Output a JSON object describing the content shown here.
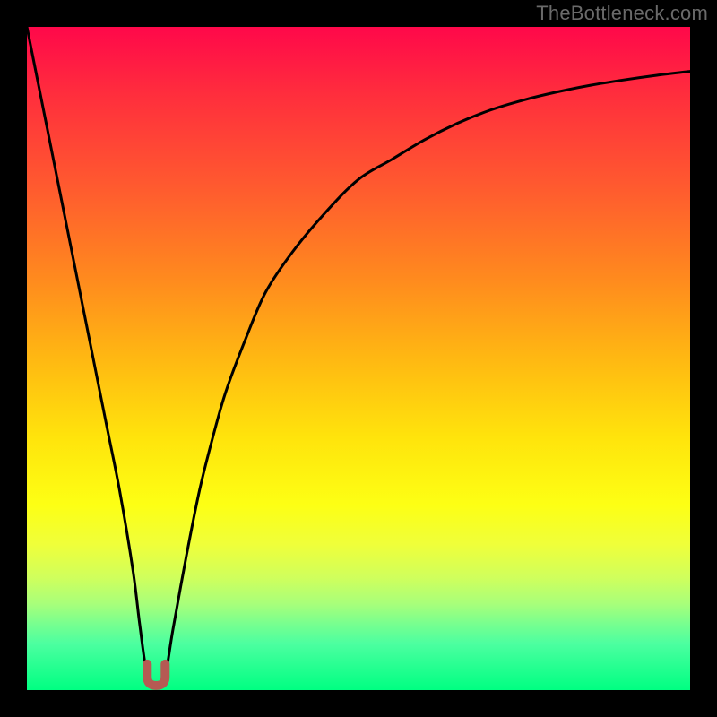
{
  "watermark": "TheBottleneck.com",
  "colors": {
    "frame": "#000000",
    "curve": "#000000",
    "marker": "#b55a53"
  },
  "chart_data": {
    "type": "line",
    "title": "",
    "xlabel": "",
    "ylabel": "",
    "xlim": [
      0,
      100
    ],
    "ylim": [
      0,
      100
    ],
    "series": [
      {
        "name": "bottleneck-curve",
        "x": [
          0,
          2,
          4,
          6,
          8,
          10,
          12,
          14,
          16,
          17,
          18,
          19,
          20,
          21,
          22,
          24,
          26,
          28,
          30,
          33,
          36,
          40,
          45,
          50,
          55,
          60,
          65,
          70,
          75,
          80,
          85,
          90,
          95,
          100
        ],
        "y": [
          100,
          90,
          80,
          70,
          60,
          50,
          40,
          30,
          18,
          10,
          3,
          1,
          1,
          3,
          9,
          20,
          30,
          38,
          45,
          53,
          60,
          66,
          72,
          77,
          80,
          83,
          85.5,
          87.5,
          89,
          90.2,
          91.2,
          92,
          92.7,
          93.3
        ]
      }
    ],
    "marker": {
      "x": 19.5,
      "y": 1.5,
      "shape": "u"
    },
    "background_gradient": {
      "top": "#ff084a",
      "mid": "#ffe40c",
      "bottom": "#00ff82"
    }
  }
}
